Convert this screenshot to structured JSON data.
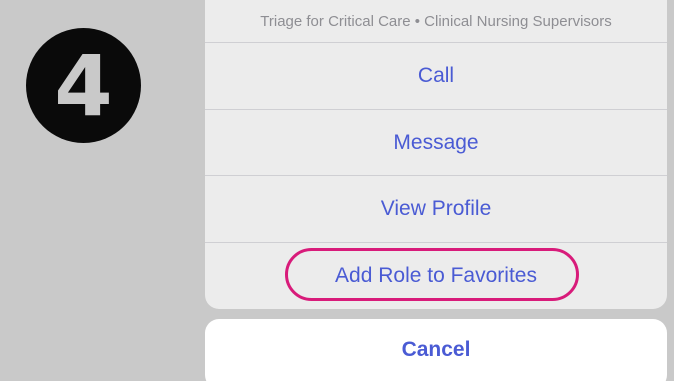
{
  "step_badge": {
    "number": "4"
  },
  "action_sheet": {
    "header": "Triage for Critical Care • Clinical Nursing Supervisors",
    "actions": [
      {
        "label": "Call"
      },
      {
        "label": "Message"
      },
      {
        "label": "View Profile"
      },
      {
        "label": "Add Role to Favorites"
      }
    ],
    "highlighted_action": "Add Role to Favorites"
  },
  "cancel": {
    "label": "Cancel"
  },
  "colors": {
    "background": "#c9c9c9",
    "accent_text": "#4a5bd4",
    "highlight_ring": "#d81b7a",
    "sheet_background": "#ececec"
  }
}
